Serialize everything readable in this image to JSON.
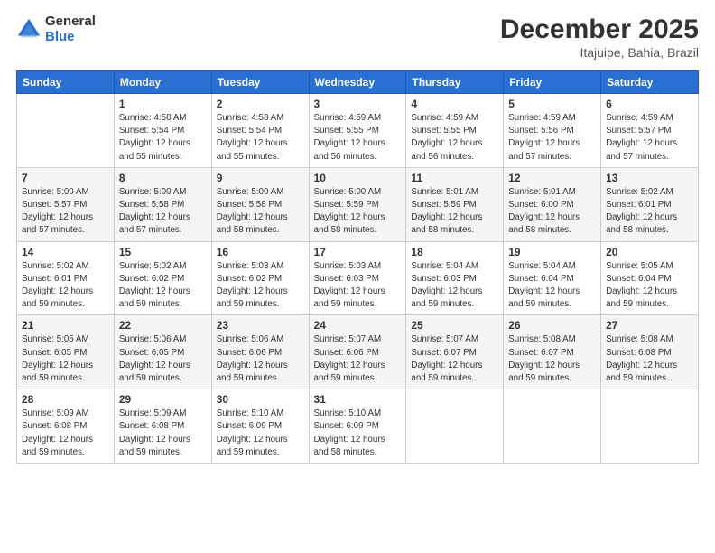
{
  "logo": {
    "general": "General",
    "blue": "Blue"
  },
  "header": {
    "month": "December 2025",
    "location": "Itajuipe, Bahia, Brazil"
  },
  "days_of_week": [
    "Sunday",
    "Monday",
    "Tuesday",
    "Wednesday",
    "Thursday",
    "Friday",
    "Saturday"
  ],
  "weeks": [
    [
      {
        "day": "",
        "content": ""
      },
      {
        "day": "1",
        "content": "Sunrise: 4:58 AM\nSunset: 5:54 PM\nDaylight: 12 hours\nand 55 minutes."
      },
      {
        "day": "2",
        "content": "Sunrise: 4:58 AM\nSunset: 5:54 PM\nDaylight: 12 hours\nand 55 minutes."
      },
      {
        "day": "3",
        "content": "Sunrise: 4:59 AM\nSunset: 5:55 PM\nDaylight: 12 hours\nand 56 minutes."
      },
      {
        "day": "4",
        "content": "Sunrise: 4:59 AM\nSunset: 5:55 PM\nDaylight: 12 hours\nand 56 minutes."
      },
      {
        "day": "5",
        "content": "Sunrise: 4:59 AM\nSunset: 5:56 PM\nDaylight: 12 hours\nand 57 minutes."
      },
      {
        "day": "6",
        "content": "Sunrise: 4:59 AM\nSunset: 5:57 PM\nDaylight: 12 hours\nand 57 minutes."
      }
    ],
    [
      {
        "day": "7",
        "content": "Sunrise: 5:00 AM\nSunset: 5:57 PM\nDaylight: 12 hours\nand 57 minutes."
      },
      {
        "day": "8",
        "content": "Sunrise: 5:00 AM\nSunset: 5:58 PM\nDaylight: 12 hours\nand 57 minutes."
      },
      {
        "day": "9",
        "content": "Sunrise: 5:00 AM\nSunset: 5:58 PM\nDaylight: 12 hours\nand 58 minutes."
      },
      {
        "day": "10",
        "content": "Sunrise: 5:00 AM\nSunset: 5:59 PM\nDaylight: 12 hours\nand 58 minutes."
      },
      {
        "day": "11",
        "content": "Sunrise: 5:01 AM\nSunset: 5:59 PM\nDaylight: 12 hours\nand 58 minutes."
      },
      {
        "day": "12",
        "content": "Sunrise: 5:01 AM\nSunset: 6:00 PM\nDaylight: 12 hours\nand 58 minutes."
      },
      {
        "day": "13",
        "content": "Sunrise: 5:02 AM\nSunset: 6:01 PM\nDaylight: 12 hours\nand 58 minutes."
      }
    ],
    [
      {
        "day": "14",
        "content": "Sunrise: 5:02 AM\nSunset: 6:01 PM\nDaylight: 12 hours\nand 59 minutes."
      },
      {
        "day": "15",
        "content": "Sunrise: 5:02 AM\nSunset: 6:02 PM\nDaylight: 12 hours\nand 59 minutes."
      },
      {
        "day": "16",
        "content": "Sunrise: 5:03 AM\nSunset: 6:02 PM\nDaylight: 12 hours\nand 59 minutes."
      },
      {
        "day": "17",
        "content": "Sunrise: 5:03 AM\nSunset: 6:03 PM\nDaylight: 12 hours\nand 59 minutes."
      },
      {
        "day": "18",
        "content": "Sunrise: 5:04 AM\nSunset: 6:03 PM\nDaylight: 12 hours\nand 59 minutes."
      },
      {
        "day": "19",
        "content": "Sunrise: 5:04 AM\nSunset: 6:04 PM\nDaylight: 12 hours\nand 59 minutes."
      },
      {
        "day": "20",
        "content": "Sunrise: 5:05 AM\nSunset: 6:04 PM\nDaylight: 12 hours\nand 59 minutes."
      }
    ],
    [
      {
        "day": "21",
        "content": "Sunrise: 5:05 AM\nSunset: 6:05 PM\nDaylight: 12 hours\nand 59 minutes."
      },
      {
        "day": "22",
        "content": "Sunrise: 5:06 AM\nSunset: 6:05 PM\nDaylight: 12 hours\nand 59 minutes."
      },
      {
        "day": "23",
        "content": "Sunrise: 5:06 AM\nSunset: 6:06 PM\nDaylight: 12 hours\nand 59 minutes."
      },
      {
        "day": "24",
        "content": "Sunrise: 5:07 AM\nSunset: 6:06 PM\nDaylight: 12 hours\nand 59 minutes."
      },
      {
        "day": "25",
        "content": "Sunrise: 5:07 AM\nSunset: 6:07 PM\nDaylight: 12 hours\nand 59 minutes."
      },
      {
        "day": "26",
        "content": "Sunrise: 5:08 AM\nSunset: 6:07 PM\nDaylight: 12 hours\nand 59 minutes."
      },
      {
        "day": "27",
        "content": "Sunrise: 5:08 AM\nSunset: 6:08 PM\nDaylight: 12 hours\nand 59 minutes."
      }
    ],
    [
      {
        "day": "28",
        "content": "Sunrise: 5:09 AM\nSunset: 6:08 PM\nDaylight: 12 hours\nand 59 minutes."
      },
      {
        "day": "29",
        "content": "Sunrise: 5:09 AM\nSunset: 6:08 PM\nDaylight: 12 hours\nand 59 minutes."
      },
      {
        "day": "30",
        "content": "Sunrise: 5:10 AM\nSunset: 6:09 PM\nDaylight: 12 hours\nand 59 minutes."
      },
      {
        "day": "31",
        "content": "Sunrise: 5:10 AM\nSunset: 6:09 PM\nDaylight: 12 hours\nand 58 minutes."
      },
      {
        "day": "",
        "content": ""
      },
      {
        "day": "",
        "content": ""
      },
      {
        "day": "",
        "content": ""
      }
    ]
  ]
}
